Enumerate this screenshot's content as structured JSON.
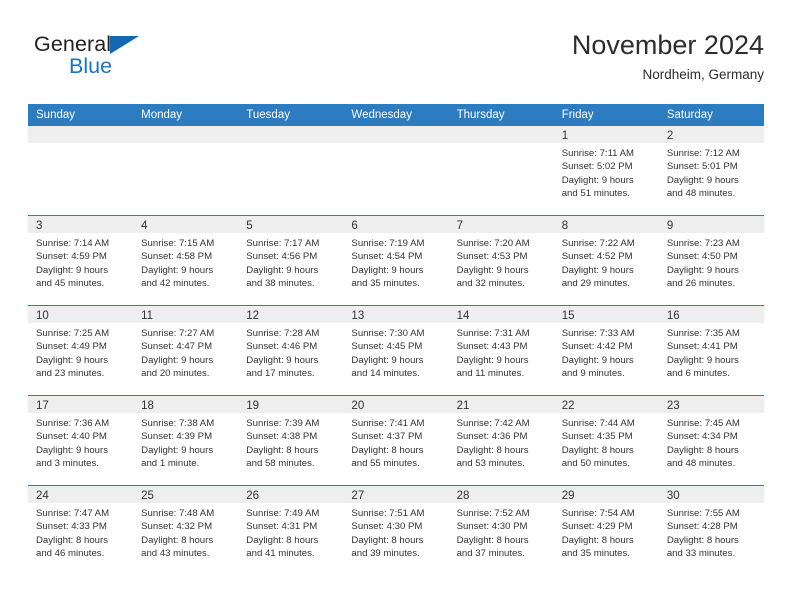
{
  "brand": {
    "word_one": "General",
    "word_two": "Blue"
  },
  "header": {
    "title": "November 2024",
    "subtitle": "Nordheim, Germany"
  },
  "colors": {
    "header_blue": "#2b7cc0",
    "brand_blue": "#1774c4",
    "day_band_gray": "#eeeeee",
    "text": "#333333"
  },
  "weekdays": [
    "Sunday",
    "Monday",
    "Tuesday",
    "Wednesday",
    "Thursday",
    "Friday",
    "Saturday"
  ],
  "weeks": [
    [
      {
        "day": "",
        "sunrise": "",
        "sunset": "",
        "daylight_line1": "",
        "daylight_line2": ""
      },
      {
        "day": "",
        "sunrise": "",
        "sunset": "",
        "daylight_line1": "",
        "daylight_line2": ""
      },
      {
        "day": "",
        "sunrise": "",
        "sunset": "",
        "daylight_line1": "",
        "daylight_line2": ""
      },
      {
        "day": "",
        "sunrise": "",
        "sunset": "",
        "daylight_line1": "",
        "daylight_line2": ""
      },
      {
        "day": "",
        "sunrise": "",
        "sunset": "",
        "daylight_line1": "",
        "daylight_line2": ""
      },
      {
        "day": "1",
        "sunrise": "Sunrise: 7:11 AM",
        "sunset": "Sunset: 5:02 PM",
        "daylight_line1": "Daylight: 9 hours",
        "daylight_line2": "and 51 minutes."
      },
      {
        "day": "2",
        "sunrise": "Sunrise: 7:12 AM",
        "sunset": "Sunset: 5:01 PM",
        "daylight_line1": "Daylight: 9 hours",
        "daylight_line2": "and 48 minutes."
      }
    ],
    [
      {
        "day": "3",
        "sunrise": "Sunrise: 7:14 AM",
        "sunset": "Sunset: 4:59 PM",
        "daylight_line1": "Daylight: 9 hours",
        "daylight_line2": "and 45 minutes."
      },
      {
        "day": "4",
        "sunrise": "Sunrise: 7:15 AM",
        "sunset": "Sunset: 4:58 PM",
        "daylight_line1": "Daylight: 9 hours",
        "daylight_line2": "and 42 minutes."
      },
      {
        "day": "5",
        "sunrise": "Sunrise: 7:17 AM",
        "sunset": "Sunset: 4:56 PM",
        "daylight_line1": "Daylight: 9 hours",
        "daylight_line2": "and 38 minutes."
      },
      {
        "day": "6",
        "sunrise": "Sunrise: 7:19 AM",
        "sunset": "Sunset: 4:54 PM",
        "daylight_line1": "Daylight: 9 hours",
        "daylight_line2": "and 35 minutes."
      },
      {
        "day": "7",
        "sunrise": "Sunrise: 7:20 AM",
        "sunset": "Sunset: 4:53 PM",
        "daylight_line1": "Daylight: 9 hours",
        "daylight_line2": "and 32 minutes."
      },
      {
        "day": "8",
        "sunrise": "Sunrise: 7:22 AM",
        "sunset": "Sunset: 4:52 PM",
        "daylight_line1": "Daylight: 9 hours",
        "daylight_line2": "and 29 minutes."
      },
      {
        "day": "9",
        "sunrise": "Sunrise: 7:23 AM",
        "sunset": "Sunset: 4:50 PM",
        "daylight_line1": "Daylight: 9 hours",
        "daylight_line2": "and 26 minutes."
      }
    ],
    [
      {
        "day": "10",
        "sunrise": "Sunrise: 7:25 AM",
        "sunset": "Sunset: 4:49 PM",
        "daylight_line1": "Daylight: 9 hours",
        "daylight_line2": "and 23 minutes."
      },
      {
        "day": "11",
        "sunrise": "Sunrise: 7:27 AM",
        "sunset": "Sunset: 4:47 PM",
        "daylight_line1": "Daylight: 9 hours",
        "daylight_line2": "and 20 minutes."
      },
      {
        "day": "12",
        "sunrise": "Sunrise: 7:28 AM",
        "sunset": "Sunset: 4:46 PM",
        "daylight_line1": "Daylight: 9 hours",
        "daylight_line2": "and 17 minutes."
      },
      {
        "day": "13",
        "sunrise": "Sunrise: 7:30 AM",
        "sunset": "Sunset: 4:45 PM",
        "daylight_line1": "Daylight: 9 hours",
        "daylight_line2": "and 14 minutes."
      },
      {
        "day": "14",
        "sunrise": "Sunrise: 7:31 AM",
        "sunset": "Sunset: 4:43 PM",
        "daylight_line1": "Daylight: 9 hours",
        "daylight_line2": "and 11 minutes."
      },
      {
        "day": "15",
        "sunrise": "Sunrise: 7:33 AM",
        "sunset": "Sunset: 4:42 PM",
        "daylight_line1": "Daylight: 9 hours",
        "daylight_line2": "and 9 minutes."
      },
      {
        "day": "16",
        "sunrise": "Sunrise: 7:35 AM",
        "sunset": "Sunset: 4:41 PM",
        "daylight_line1": "Daylight: 9 hours",
        "daylight_line2": "and 6 minutes."
      }
    ],
    [
      {
        "day": "17",
        "sunrise": "Sunrise: 7:36 AM",
        "sunset": "Sunset: 4:40 PM",
        "daylight_line1": "Daylight: 9 hours",
        "daylight_line2": "and 3 minutes."
      },
      {
        "day": "18",
        "sunrise": "Sunrise: 7:38 AM",
        "sunset": "Sunset: 4:39 PM",
        "daylight_line1": "Daylight: 9 hours",
        "daylight_line2": "and 1 minute."
      },
      {
        "day": "19",
        "sunrise": "Sunrise: 7:39 AM",
        "sunset": "Sunset: 4:38 PM",
        "daylight_line1": "Daylight: 8 hours",
        "daylight_line2": "and 58 minutes."
      },
      {
        "day": "20",
        "sunrise": "Sunrise: 7:41 AM",
        "sunset": "Sunset: 4:37 PM",
        "daylight_line1": "Daylight: 8 hours",
        "daylight_line2": "and 55 minutes."
      },
      {
        "day": "21",
        "sunrise": "Sunrise: 7:42 AM",
        "sunset": "Sunset: 4:36 PM",
        "daylight_line1": "Daylight: 8 hours",
        "daylight_line2": "and 53 minutes."
      },
      {
        "day": "22",
        "sunrise": "Sunrise: 7:44 AM",
        "sunset": "Sunset: 4:35 PM",
        "daylight_line1": "Daylight: 8 hours",
        "daylight_line2": "and 50 minutes."
      },
      {
        "day": "23",
        "sunrise": "Sunrise: 7:45 AM",
        "sunset": "Sunset: 4:34 PM",
        "daylight_line1": "Daylight: 8 hours",
        "daylight_line2": "and 48 minutes."
      }
    ],
    [
      {
        "day": "24",
        "sunrise": "Sunrise: 7:47 AM",
        "sunset": "Sunset: 4:33 PM",
        "daylight_line1": "Daylight: 8 hours",
        "daylight_line2": "and 46 minutes."
      },
      {
        "day": "25",
        "sunrise": "Sunrise: 7:48 AM",
        "sunset": "Sunset: 4:32 PM",
        "daylight_line1": "Daylight: 8 hours",
        "daylight_line2": "and 43 minutes."
      },
      {
        "day": "26",
        "sunrise": "Sunrise: 7:49 AM",
        "sunset": "Sunset: 4:31 PM",
        "daylight_line1": "Daylight: 8 hours",
        "daylight_line2": "and 41 minutes."
      },
      {
        "day": "27",
        "sunrise": "Sunrise: 7:51 AM",
        "sunset": "Sunset: 4:30 PM",
        "daylight_line1": "Daylight: 8 hours",
        "daylight_line2": "and 39 minutes."
      },
      {
        "day": "28",
        "sunrise": "Sunrise: 7:52 AM",
        "sunset": "Sunset: 4:30 PM",
        "daylight_line1": "Daylight: 8 hours",
        "daylight_line2": "and 37 minutes."
      },
      {
        "day": "29",
        "sunrise": "Sunrise: 7:54 AM",
        "sunset": "Sunset: 4:29 PM",
        "daylight_line1": "Daylight: 8 hours",
        "daylight_line2": "and 35 minutes."
      },
      {
        "day": "30",
        "sunrise": "Sunrise: 7:55 AM",
        "sunset": "Sunset: 4:28 PM",
        "daylight_line1": "Daylight: 8 hours",
        "daylight_line2": "and 33 minutes."
      }
    ]
  ]
}
